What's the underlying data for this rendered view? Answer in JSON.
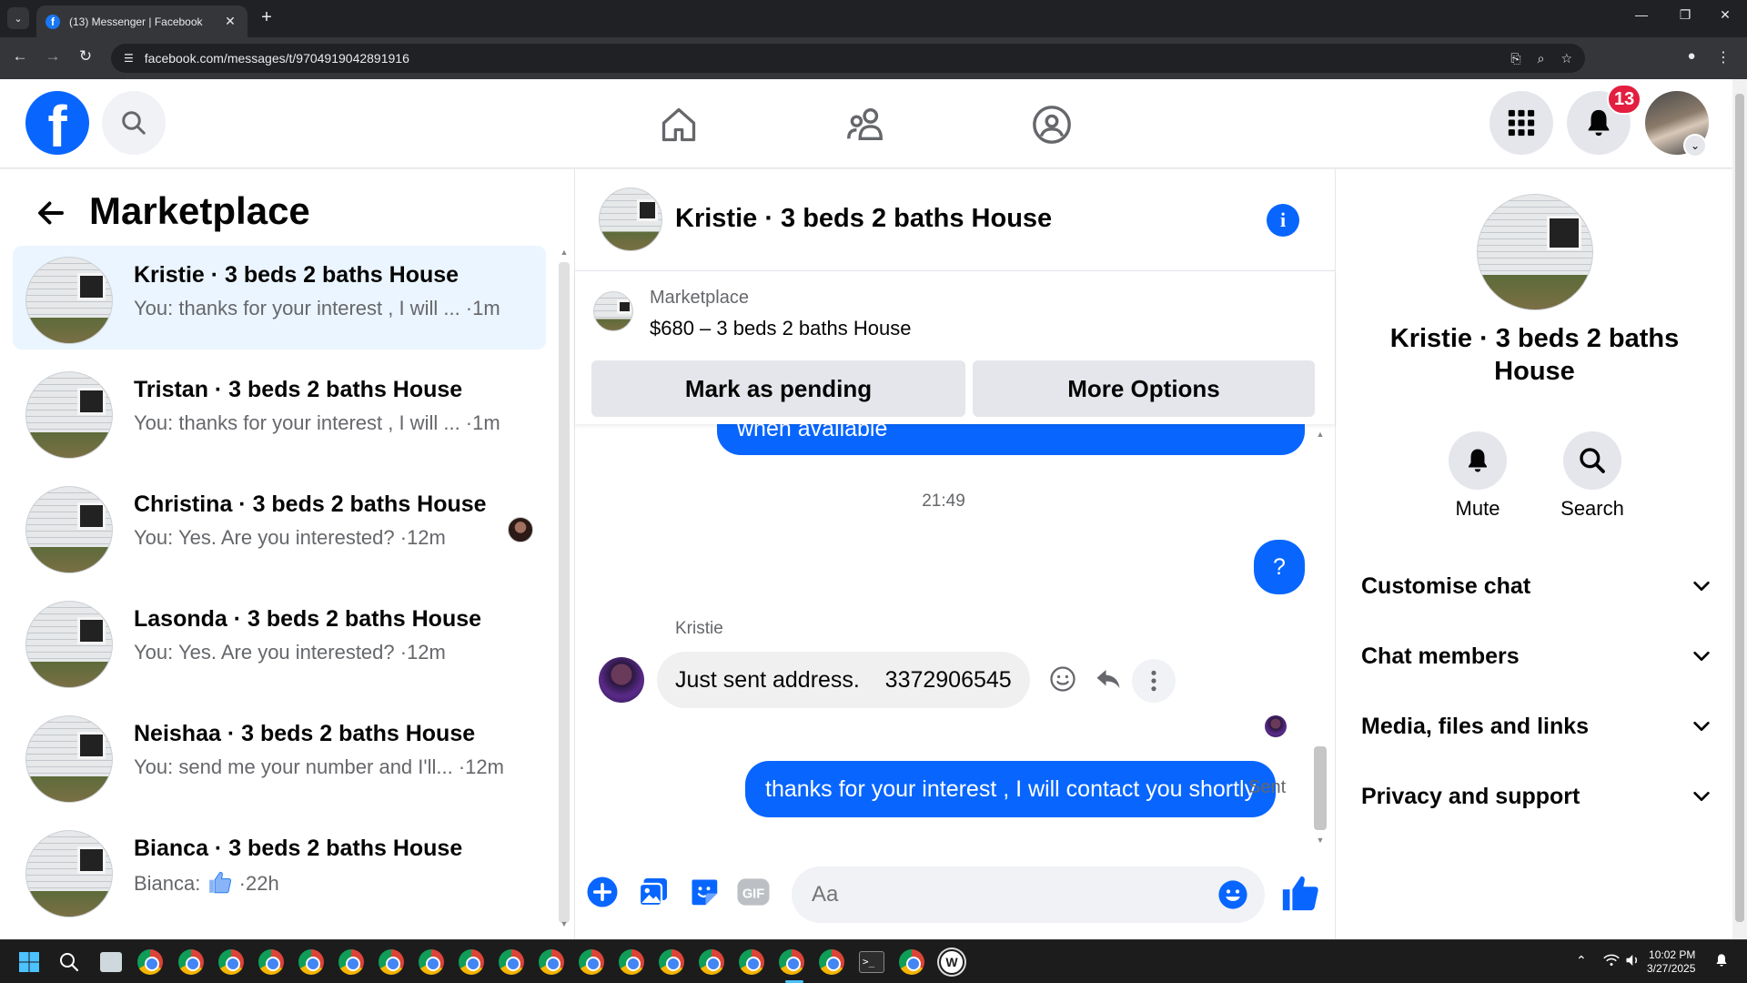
{
  "browser": {
    "tab_title": "(13) Messenger | Facebook",
    "url": "facebook.com/messages/t/9704919042891916"
  },
  "header": {
    "notification_count": "13"
  },
  "left_panel": {
    "title": "Marketplace",
    "conversations": [
      {
        "name": "Kristie · 3 beds 2 baths House",
        "preview": "You: thanks for your interest , I will ... ·1m",
        "active": true
      },
      {
        "name": "Tristan · 3 beds 2 baths House",
        "preview": "You: thanks for your interest , I will ... ·1m"
      },
      {
        "name": "Christina · 3 beds 2 baths House",
        "preview": "You: Yes. Are you interested? ·12m",
        "seen_avatar": true
      },
      {
        "name": "Lasonda · 3 beds 2 baths House",
        "preview": "You: Yes. Are you interested? ·12m"
      },
      {
        "name": "Neishaa · 3 beds 2 baths House",
        "preview": "You: send me your number and I'll... ·12m"
      },
      {
        "name": "Bianca · 3 beds 2 baths House",
        "preview_prefix": "Bianca:",
        "preview_suffix": "·22h",
        "thumb_icon": "thumbs-up-icon"
      }
    ]
  },
  "chat": {
    "title": "Kristie · 3 beds 2 baths House",
    "listing": {
      "label": "Marketplace",
      "detail": "$680 – 3 beds 2 baths House",
      "mark_pending": "Mark as pending",
      "more_options": "More Options"
    },
    "messages": {
      "partial_out": "when available",
      "timestamp": "21:49",
      "out_question": "?",
      "sender": "Kristie",
      "incoming": "Just sent address.    3372906545",
      "last_out": "thanks for your interest , I will contact you shortly",
      "status": "Sent"
    },
    "composer": {
      "placeholder": "Aa"
    }
  },
  "right_panel": {
    "name": "Kristie · 3 beds 2 baths House",
    "actions": [
      {
        "label": "Mute",
        "icon": "bell-icon"
      },
      {
        "label": "Search",
        "icon": "search-icon"
      }
    ],
    "sections": [
      {
        "label": "Customise chat"
      },
      {
        "label": "Chat members"
      },
      {
        "label": "Media, files and links"
      },
      {
        "label": "Privacy and support"
      }
    ]
  },
  "taskbar": {
    "time": "10:02 PM",
    "date": "3/27/2025"
  },
  "colors": {
    "fb_blue": "#0866ff",
    "badge_red": "#e41e3f",
    "active_row": "#ebf5ff"
  }
}
